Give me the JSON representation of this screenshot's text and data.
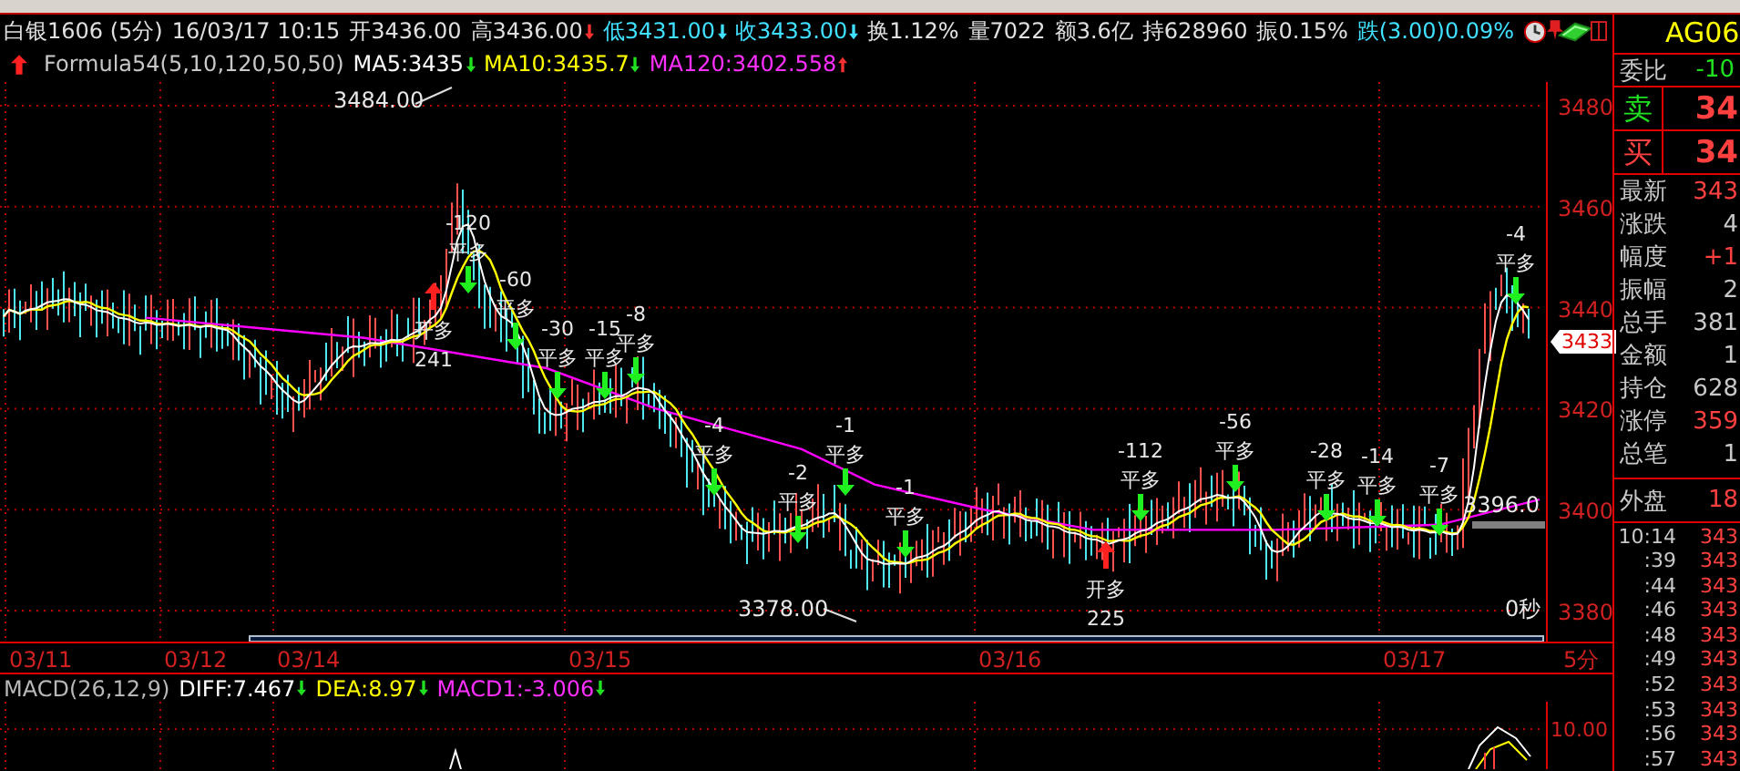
{
  "header": {
    "quote": [
      {
        "text": "白银1606 (5分)",
        "color": "#e0e0e0"
      },
      {
        "text": "16/03/17 10:15",
        "color": "#e0e0e0"
      },
      {
        "text": "开3436.00",
        "color": "#e0e0e0"
      },
      {
        "text": "高3436.00",
        "color": "#e0e0e0",
        "arrow": {
          "up": false,
          "color": "#ff3030"
        }
      },
      {
        "text": "低3431.00",
        "color": "#40e0ff",
        "arrow": {
          "up": false,
          "color": "#40e0ff"
        }
      },
      {
        "text": "收3433.00",
        "color": "#40e0ff",
        "arrow": {
          "up": false,
          "color": "#40e0ff"
        }
      },
      {
        "text": "换1.12%",
        "color": "#e0e0e0"
      },
      {
        "text": "量7022",
        "color": "#e0e0e0"
      },
      {
        "text": "额3.6亿",
        "color": "#e0e0e0"
      },
      {
        "text": "持628960",
        "color": "#e0e0e0"
      },
      {
        "text": "振0.15%",
        "color": "#e0e0e0"
      },
      {
        "text": "跌(3.00)0.09%",
        "color": "#40e0ff"
      }
    ],
    "indicators": [
      {
        "text": "Formula54(5,10,120,50,50)",
        "color": "#c8c8c8"
      },
      {
        "text": "MA5:3435",
        "color": "#ffffff",
        "arrow": {
          "up": false,
          "color": "#20e020"
        }
      },
      {
        "text": "MA10:3435.7",
        "color": "#ffff00",
        "arrow": {
          "up": false,
          "color": "#20e020"
        }
      },
      {
        "text": "MA120:3402.558",
        "color": "#ff30ff",
        "arrow": {
          "up": true,
          "color": "#ff3030"
        }
      }
    ]
  },
  "chart": {
    "high_label": "3484.00",
    "low_label": "3378.00",
    "line_value": "3396.0",
    "countdown": "0秒",
    "last_price": "3433",
    "price_ticks": [
      "3480",
      "3460",
      "3440",
      "3420",
      "3400",
      "3380"
    ],
    "date_labels": [
      "03/11",
      "03/12",
      "03/14",
      "03/15",
      "03/16",
      "03/17"
    ],
    "period": "5分",
    "signals": [
      {
        "kind": "open",
        "action": "开多",
        "qty": "241"
      },
      {
        "kind": "close",
        "qty": "-120",
        "action": "平多"
      },
      {
        "kind": "close",
        "qty": "-60",
        "action": "平多"
      },
      {
        "kind": "close",
        "qty": "-30",
        "action": "平多"
      },
      {
        "kind": "close",
        "qty": "-15",
        "action": "平多"
      },
      {
        "kind": "close",
        "qty": "-8",
        "action": "平多"
      },
      {
        "kind": "close",
        "qty": "-4",
        "action": "平多"
      },
      {
        "kind": "close",
        "qty": "-2",
        "action": "平多"
      },
      {
        "kind": "close",
        "qty": "-1",
        "action": "平多"
      },
      {
        "kind": "close",
        "qty": "-1",
        "action": "平多"
      },
      {
        "kind": "open",
        "action": "开多",
        "qty": "225"
      },
      {
        "kind": "close",
        "qty": "-112",
        "action": "平多"
      },
      {
        "kind": "close",
        "qty": "-56",
        "action": "平多"
      },
      {
        "kind": "close",
        "qty": "-28",
        "action": "平多"
      },
      {
        "kind": "close",
        "qty": "-14",
        "action": "平多"
      },
      {
        "kind": "close",
        "qty": "-7",
        "action": "平多"
      },
      {
        "kind": "close",
        "qty": "-4",
        "action": "平多"
      }
    ]
  },
  "macd": {
    "indicators": [
      {
        "text": "MACD(26,12,9)",
        "color": "#b8b8b8"
      },
      {
        "text": "DIFF:7.467",
        "color": "#ffffff",
        "arrow": {
          "up": false,
          "color": "#20e020"
        }
      },
      {
        "text": "DEA:8.97",
        "color": "#ffff00",
        "arrow": {
          "up": false,
          "color": "#20e020"
        }
      },
      {
        "text": "MACD1:-3.006",
        "color": "#ff30ff",
        "arrow": {
          "up": false,
          "color": "#20e020"
        }
      }
    ],
    "tick": "10.00"
  },
  "right_panel": {
    "symbol": "AG06",
    "rows": [
      {
        "kind": "ratio",
        "label": "委比",
        "value": "-10",
        "color": "#20e020"
      },
      {
        "kind": "ask",
        "label": "卖",
        "value": "34",
        "color": "#ff4040"
      },
      {
        "kind": "bid",
        "label": "买",
        "value": "34",
        "color": "#ff4040"
      },
      {
        "kind": "stat",
        "label": "最新",
        "value": "343",
        "color": "#ff4040"
      },
      {
        "kind": "stat",
        "label": "涨跌",
        "value": "4",
        "color": "#c8c8c8"
      },
      {
        "kind": "stat",
        "label": "幅度",
        "value": "+1",
        "color": "#ff4040"
      },
      {
        "kind": "stat",
        "label": "振幅",
        "value": "2",
        "color": "#c8c8c8"
      },
      {
        "kind": "stat",
        "label": "总手",
        "value": "381",
        "color": "#c8c8c8"
      },
      {
        "kind": "stat",
        "label": "金额",
        "value": "1",
        "color": "#c8c8c8"
      },
      {
        "kind": "stat",
        "label": "持仓",
        "value": "628",
        "color": "#c8c8c8"
      },
      {
        "kind": "stat",
        "label": "涨停",
        "value": "359",
        "color": "#ff4040"
      },
      {
        "kind": "stat",
        "label": "总笔",
        "value": "1",
        "color": "#c8c8c8"
      },
      {
        "kind": "outer",
        "label": "外盘",
        "value": "18",
        "color": "#ff4040"
      },
      {
        "kind": "tick",
        "label": "10:14",
        "value": "343",
        "color": "#ff4040"
      },
      {
        "kind": "tick",
        "label": ":39",
        "value": "343",
        "color": "#ff4040"
      },
      {
        "kind": "tick",
        "label": ":44",
        "value": "343",
        "color": "#ff4040"
      },
      {
        "kind": "tick",
        "label": ":46",
        "value": "343",
        "color": "#ff4040"
      },
      {
        "kind": "tick",
        "label": ":48",
        "value": "343",
        "color": "#ff4040"
      },
      {
        "kind": "tick",
        "label": ":49",
        "value": "343",
        "color": "#ff4040"
      },
      {
        "kind": "tick",
        "label": ":52",
        "value": "343",
        "color": "#ff4040"
      },
      {
        "kind": "tick",
        "label": ":53",
        "value": "343",
        "color": "#ff4040"
      },
      {
        "kind": "tick",
        "label": ":56",
        "value": "343",
        "color": "#ff4040"
      },
      {
        "kind": "tick",
        "label": ":57",
        "value": "343",
        "color": "#ff4040"
      }
    ]
  }
}
